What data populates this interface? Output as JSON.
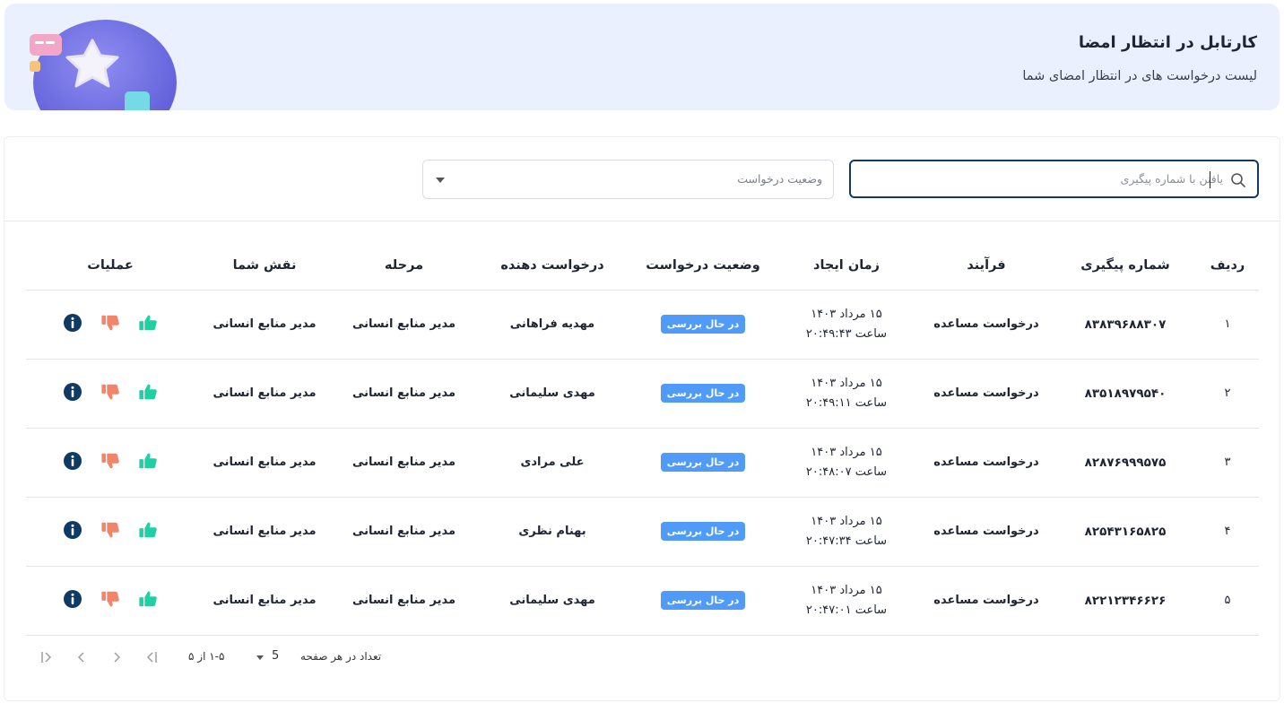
{
  "header": {
    "title": "کارتابل در انتظار امضا",
    "subtitle": "لیست درخواست های در انتظار امضای شما"
  },
  "filters": {
    "search_placeholder": "یافتن با شماره پیگیری",
    "status_select_label": "وضعیت درخواست"
  },
  "table": {
    "columns": [
      "ردیف",
      "شماره پیگیری",
      "فرآیند",
      "زمان ایجاد",
      "وضعیت درخواست",
      "درخواست دهنده",
      "مرحله",
      "نقش شما",
      "عملیات"
    ],
    "rows": [
      {
        "index": "۱",
        "tracking": "۸۳۸۳۹۶۸۸۳۰۷",
        "process": "درخواست مساعده",
        "date": "۱۵ مرداد ۱۴۰۳",
        "time": "ساعت ۲۰:۴۹:۴۳",
        "status": "در حال بررسی",
        "requester": "مهدیه فراهانی",
        "stage": "مدیر منابع انسانی",
        "role": "مدیر منابع انسانی"
      },
      {
        "index": "۲",
        "tracking": "۸۳۵۱۸۹۷۹۵۴۰",
        "process": "درخواست مساعده",
        "date": "۱۵ مرداد ۱۴۰۳",
        "time": "ساعت ۲۰:۴۹:۱۱",
        "status": "در حال بررسی",
        "requester": "مهدی سلیمانی",
        "stage": "مدیر منابع انسانی",
        "role": "مدیر منابع انسانی"
      },
      {
        "index": "۳",
        "tracking": "۸۲۸۷۶۹۹۹۵۷۵",
        "process": "درخواست مساعده",
        "date": "۱۵ مرداد ۱۴۰۳",
        "time": "ساعت ۲۰:۴۸:۰۷",
        "status": "در حال بررسی",
        "requester": "علی مرادی",
        "stage": "مدیر منابع انسانی",
        "role": "مدیر منابع انسانی"
      },
      {
        "index": "۴",
        "tracking": "۸۲۵۴۳۱۶۵۸۲۵",
        "process": "درخواست مساعده",
        "date": "۱۵ مرداد ۱۴۰۳",
        "time": "ساعت ۲۰:۴۷:۳۴",
        "status": "در حال بررسی",
        "requester": "بهنام نظری",
        "stage": "مدیر منابع انسانی",
        "role": "مدیر منابع انسانی"
      },
      {
        "index": "۵",
        "tracking": "۸۲۲۱۲۳۴۶۶۲۶",
        "process": "درخواست مساعده",
        "date": "۱۵ مرداد ۱۴۰۳",
        "time": "ساعت ۲۰:۴۷:۰۱",
        "status": "در حال بررسی",
        "requester": "مهدی سلیمانی",
        "stage": "مدیر منابع انسانی",
        "role": "مدیر منابع انسانی"
      }
    ]
  },
  "pagination": {
    "rows_per_page_label": "تعداد در هر صفحه",
    "rows_per_page_value": "5",
    "range_text": "۱-۵ از ۵"
  },
  "colors": {
    "accent": "#123a5e",
    "badge": "#4f9bf7",
    "approve": "#1ed0a2",
    "reject": "#f2846a",
    "info": "#0f3a63",
    "banner_bg": "#eaf0fd"
  },
  "icons": {
    "search": "search-icon",
    "approve": "thumbs-up-icon",
    "reject": "thumbs-down-icon",
    "info": "info-icon"
  }
}
